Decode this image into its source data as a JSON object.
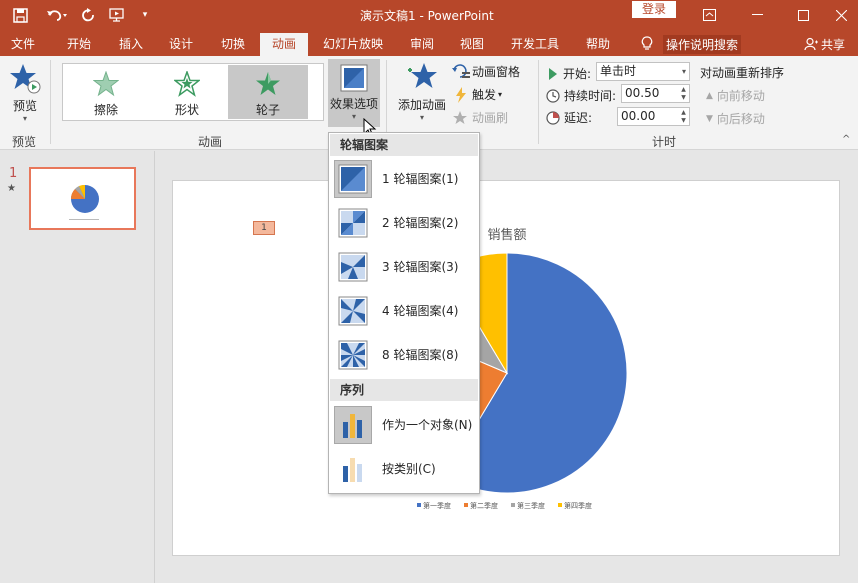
{
  "app": {
    "doc_title": "演示文稿1  -  PowerPoint",
    "login_label": "登录"
  },
  "tabs": [
    {
      "label": "文件"
    },
    {
      "label": "开始"
    },
    {
      "label": "插入"
    },
    {
      "label": "设计"
    },
    {
      "label": "切换"
    },
    {
      "label": "动画",
      "active": true
    },
    {
      "label": "幻灯片放映"
    },
    {
      "label": "审阅"
    },
    {
      "label": "视图"
    },
    {
      "label": "开发工具"
    },
    {
      "label": "帮助"
    }
  ],
  "tell_me": "操作说明搜索",
  "share": "共享",
  "ribbon": {
    "preview_label": "预览",
    "preview_group": "预览",
    "gallery_items": [
      {
        "label": "擦除",
        "color": "#74b28c"
      },
      {
        "label": "形状",
        "color": "#3d9b61"
      },
      {
        "label": "轮子",
        "color": "#3d9b61",
        "selected": true
      }
    ],
    "animation_group": "动画",
    "effect_options_label": "效果选项",
    "add_animation_label": "添加动画",
    "animation_pane_label": "动画窗格",
    "trigger_label": "触发",
    "anim_painter_label": "动画刷",
    "timing": {
      "start_label": "开始:",
      "start_value": "单击时",
      "duration_label": "持续时间:",
      "duration_value": "00.50",
      "delay_label": "延迟:",
      "delay_value": "00.00"
    },
    "reorder_label": "对动画重新排序",
    "move_earlier": "向前移动",
    "move_later": "向后移动",
    "timing_group": "计时"
  },
  "thumbs": {
    "slide_number": "1",
    "star": "★"
  },
  "slide": {
    "anim_tag": "1"
  },
  "chart_data": {
    "type": "pie",
    "title": "销售额",
    "categories": [
      "第一季度",
      "第二季度",
      "第三季度",
      "第四季度"
    ],
    "values": [
      8.2,
      3.2,
      1.4,
      1.2
    ],
    "colors": [
      "#4472c4",
      "#ed7d31",
      "#a5a5a5",
      "#ffc000"
    ],
    "legend_position": "bottom"
  },
  "dropdown": {
    "section1": "轮辐图案",
    "spokes": [
      {
        "label": "1 轮辐图案(1)",
        "spokes": 1,
        "selected": true
      },
      {
        "label": "2 轮辐图案(2)",
        "spokes": 2
      },
      {
        "label": "3 轮辐图案(3)",
        "spokes": 3
      },
      {
        "label": "4 轮辐图案(4)",
        "spokes": 4
      },
      {
        "label": "8 轮辐图案(8)",
        "spokes": 8
      }
    ],
    "section2": "序列",
    "sequence": [
      {
        "label": "作为一个对象(N)",
        "selected": true
      },
      {
        "label": "按类别(C)"
      }
    ]
  }
}
